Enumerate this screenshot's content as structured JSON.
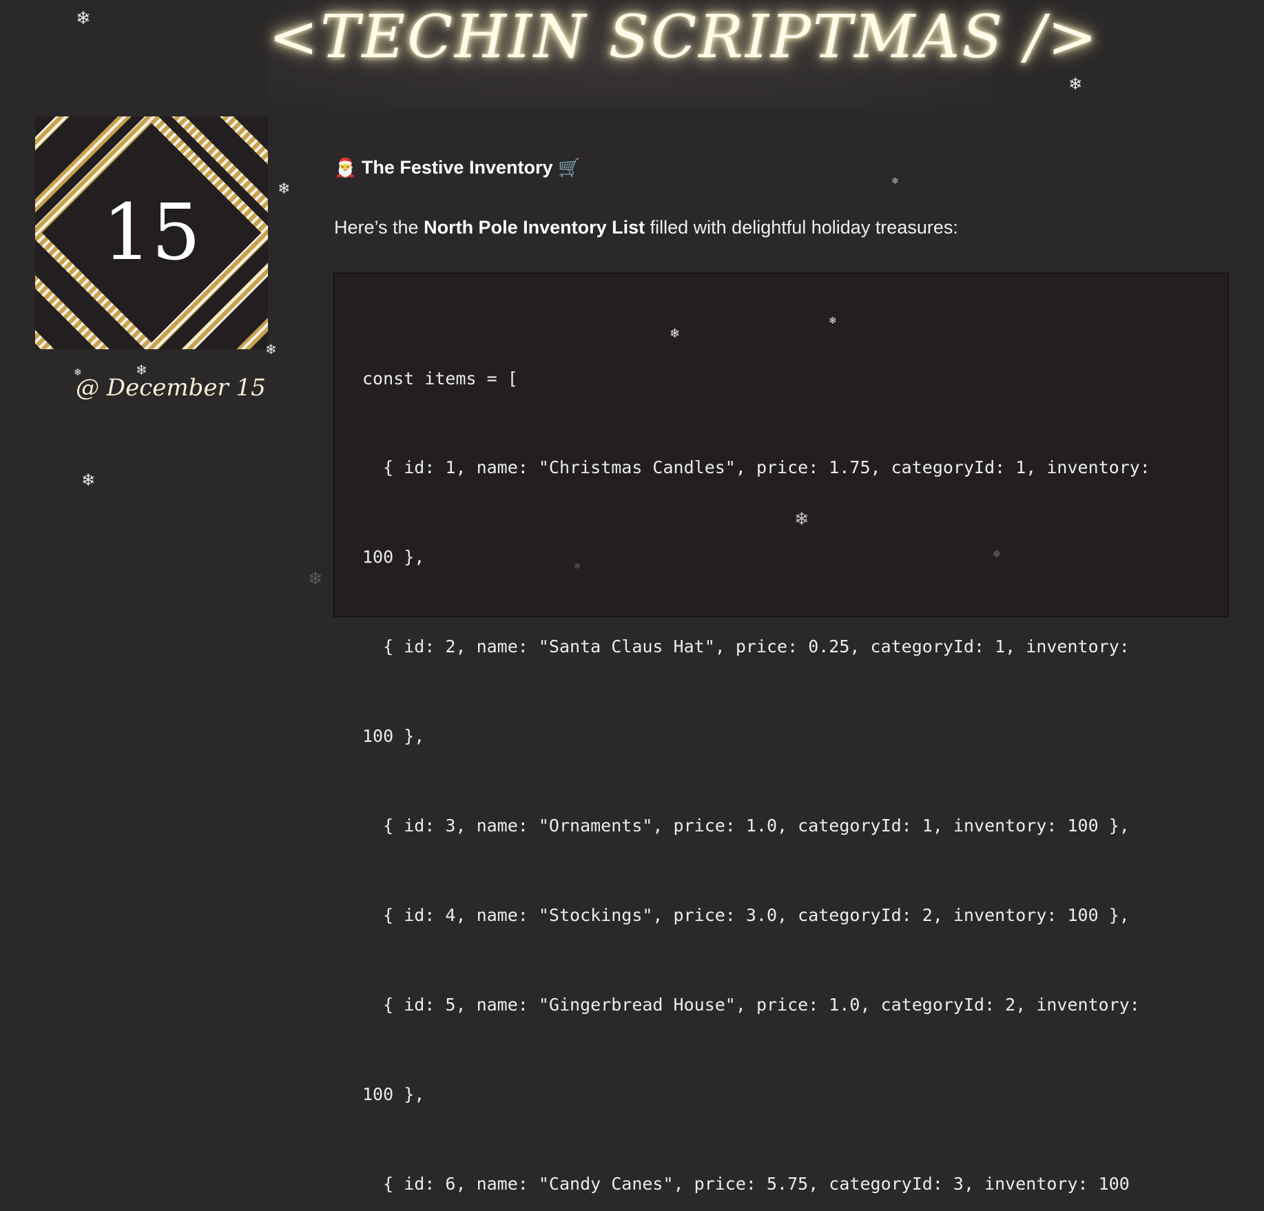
{
  "header": {
    "title": "<TECHIN SCRIPTMAS />"
  },
  "calendar_tile": {
    "day": "15",
    "date_label": "@ December 15"
  },
  "post": {
    "heading_emoji_left": "🎅",
    "heading": "The Festive Inventory",
    "heading_emoji_right": "🛒",
    "intro_before": "Here’s the ",
    "intro_bold": "North Pole Inventory List",
    "intro_after": " filled with delightful holiday treasures:",
    "code_lines": [
      "const items = [",
      "  { id: 1, name: \"Christmas Candles\", price: 1.75, categoryId: 1, inventory:",
      "100 },",
      "  { id: 2, name: \"Santa Claus Hat\", price: 0.25, categoryId: 1, inventory:",
      "100 },",
      "  { id: 3, name: \"Ornaments\", price: 1.0, categoryId: 1, inventory: 100 },",
      "  { id: 4, name: \"Stockings\", price: 3.0, categoryId: 2, inventory: 100 },",
      "  { id: 5, name: \"Gingerbread House\", price: 1.0, categoryId: 2, inventory:",
      "100 },",
      "  { id: 6, name: \"Candy Canes\", price: 5.75, categoryId: 3, inventory: 100"
    ]
  },
  "decor": {
    "snowflake_glyph": "❄",
    "tile_stripe_colors": [
      "#c9a24e",
      "#f6f2e6"
    ],
    "background_color": "#2b2829",
    "tile_background_color": "#231f20",
    "code_background_color": "#231f20"
  }
}
